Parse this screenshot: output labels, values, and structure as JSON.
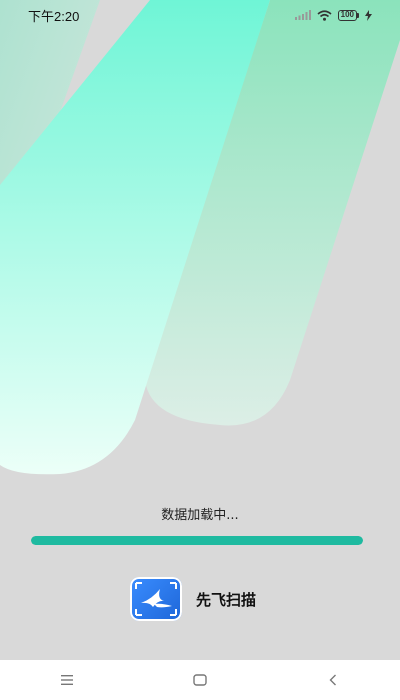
{
  "status_bar": {
    "time": "下午2:20",
    "battery_level": "100",
    "icons": [
      "signal-icon",
      "wifi-icon",
      "battery-icon",
      "charging-icon"
    ]
  },
  "loading": {
    "text": "数据加载中...",
    "progress_percent": 100,
    "progress_color": "#1ebaa0"
  },
  "brand": {
    "app_name": "先飞扫描",
    "logo_icon": "bird-logo-icon"
  },
  "nav_bar": {
    "buttons": [
      "menu-icon",
      "home-icon",
      "back-icon"
    ]
  },
  "colors": {
    "background": "#d9d9d9",
    "accent": "#1ebaa0",
    "logo_blue": "#2f7ef0"
  }
}
